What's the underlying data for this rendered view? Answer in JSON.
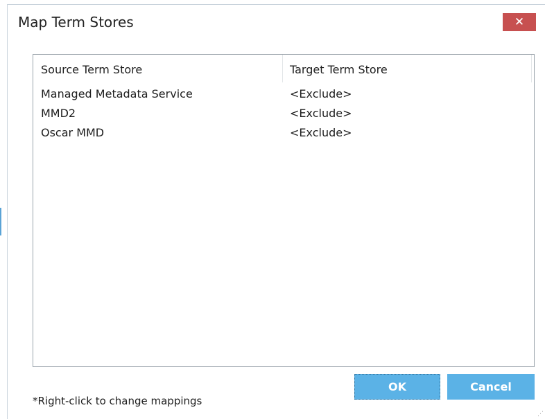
{
  "window": {
    "title": "Map Term Stores",
    "close_label": "✕"
  },
  "list": {
    "columns": [
      "Source Term Store",
      "Target Term Store"
    ],
    "rows": [
      {
        "source": "Managed Metadata Service",
        "target": "<Exclude>"
      },
      {
        "source": "MMD2",
        "target": "<Exclude>"
      },
      {
        "source": "Oscar MMD",
        "target": "<Exclude>"
      }
    ]
  },
  "footer": {
    "hint": "*Right-click to change mappings",
    "ok_label": "OK",
    "cancel_label": "Cancel"
  },
  "colors": {
    "close_button": "#c75050",
    "primary_button": "#5bb2e6"
  }
}
